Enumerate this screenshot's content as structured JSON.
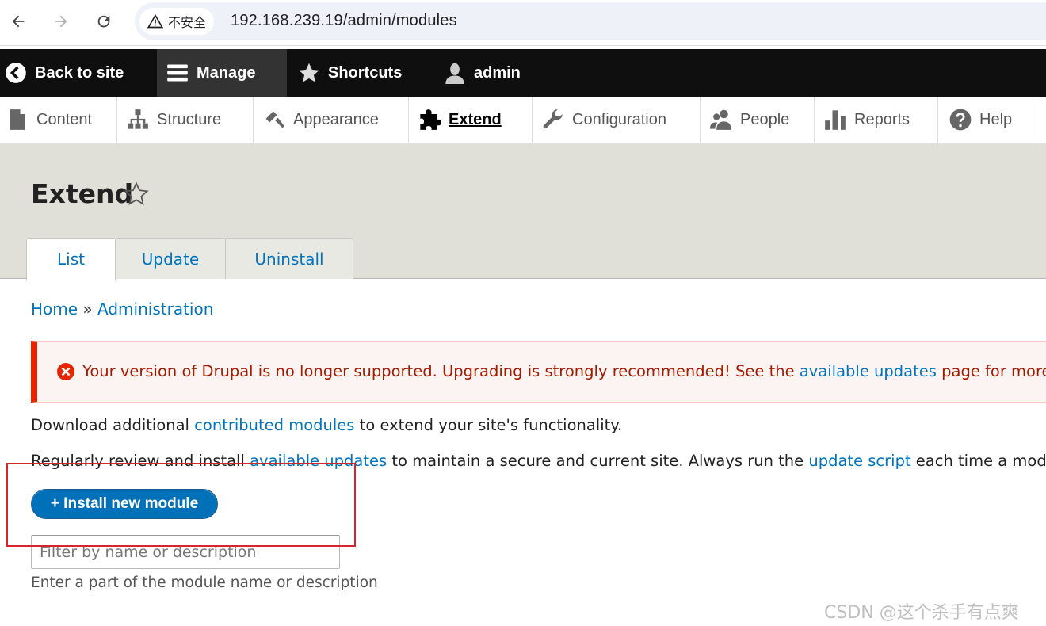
{
  "browser": {
    "security_label": "不安全",
    "url": "192.168.239.19/admin/modules"
  },
  "toolbar": {
    "back_to_site": "Back to site",
    "manage": "Manage",
    "shortcuts": "Shortcuts",
    "user": "admin"
  },
  "menu": {
    "items": [
      {
        "label": "Content",
        "icon": "file-icon"
      },
      {
        "label": "Structure",
        "icon": "sitemap-icon"
      },
      {
        "label": "Appearance",
        "icon": "paintbrush-icon"
      },
      {
        "label": "Extend",
        "icon": "puzzle-icon",
        "active": true
      },
      {
        "label": "Configuration",
        "icon": "wrench-icon"
      },
      {
        "label": "People",
        "icon": "people-icon"
      },
      {
        "label": "Reports",
        "icon": "bar-chart-icon"
      },
      {
        "label": "Help",
        "icon": "help-icon"
      }
    ]
  },
  "page": {
    "title": "Extend",
    "tabs": [
      {
        "label": "List",
        "active": true
      },
      {
        "label": "Update"
      },
      {
        "label": "Uninstall"
      }
    ]
  },
  "breadcrumb": {
    "home": "Home",
    "separator": "»",
    "admin": "Administration"
  },
  "error_message": {
    "before": "Your version of Drupal is no longer supported. Upgrading is strongly recommended! See the ",
    "link": "available updates",
    "after": " page for more inf"
  },
  "content": {
    "para1_before": "Download additional ",
    "para1_link": "contributed modules",
    "para1_after": " to extend your site's functionality.",
    "para2_before": "Regularly review and install ",
    "para2_link1": "available updates",
    "para2_middle": " to maintain a secure and current site. Always run the ",
    "para2_link2": "update script",
    "para2_after": " each time a module is",
    "install_button": "+ Install new module",
    "filter_placeholder": "Filter by name or description",
    "filter_description": "Enter a part of the module name or description"
  },
  "watermark": "CSDN @这个杀手有点爽",
  "colors": {
    "link": "#0074bd",
    "error_border": "#e62600",
    "error_text": "#a51b00",
    "button": "#0071b8",
    "toolbar": "#0f0f0f"
  }
}
